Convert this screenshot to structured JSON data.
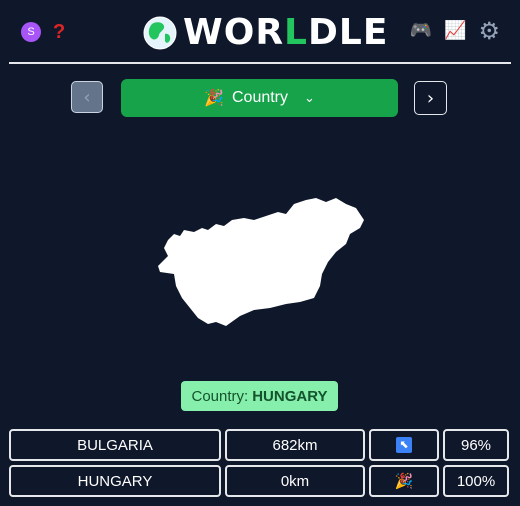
{
  "header": {
    "sponsor_letter": "S",
    "help_symbol": "?",
    "title_part1": "WOR",
    "title_green": "L",
    "title_part2": "DLE",
    "icons": [
      "sponsor-icon",
      "help-icon",
      "globe-icon",
      "gamepad-icon",
      "stats-icon",
      "gear-icon"
    ]
  },
  "nav": {
    "prev_symbol": "‹",
    "next_symbol": "›",
    "mode_emoji": "🎉",
    "mode_label": "Country",
    "mode_chevron": "⌄"
  },
  "answer": {
    "prefix": "Country:",
    "country": "HUNGARY"
  },
  "guesses": [
    {
      "country": "BULGARIA",
      "distance": "682km",
      "direction_symbol": "⬉",
      "direction": "north-west",
      "proximity": "96%"
    },
    {
      "country": "HUNGARY",
      "distance": "0km",
      "direction_symbol": "🎉",
      "direction": "correct",
      "proximity": "100%"
    }
  ],
  "colors": {
    "background": "#0f172a",
    "accent_green": "#16a34a",
    "answer_bg": "#86efac",
    "direction_blue": "#3b82f6"
  }
}
